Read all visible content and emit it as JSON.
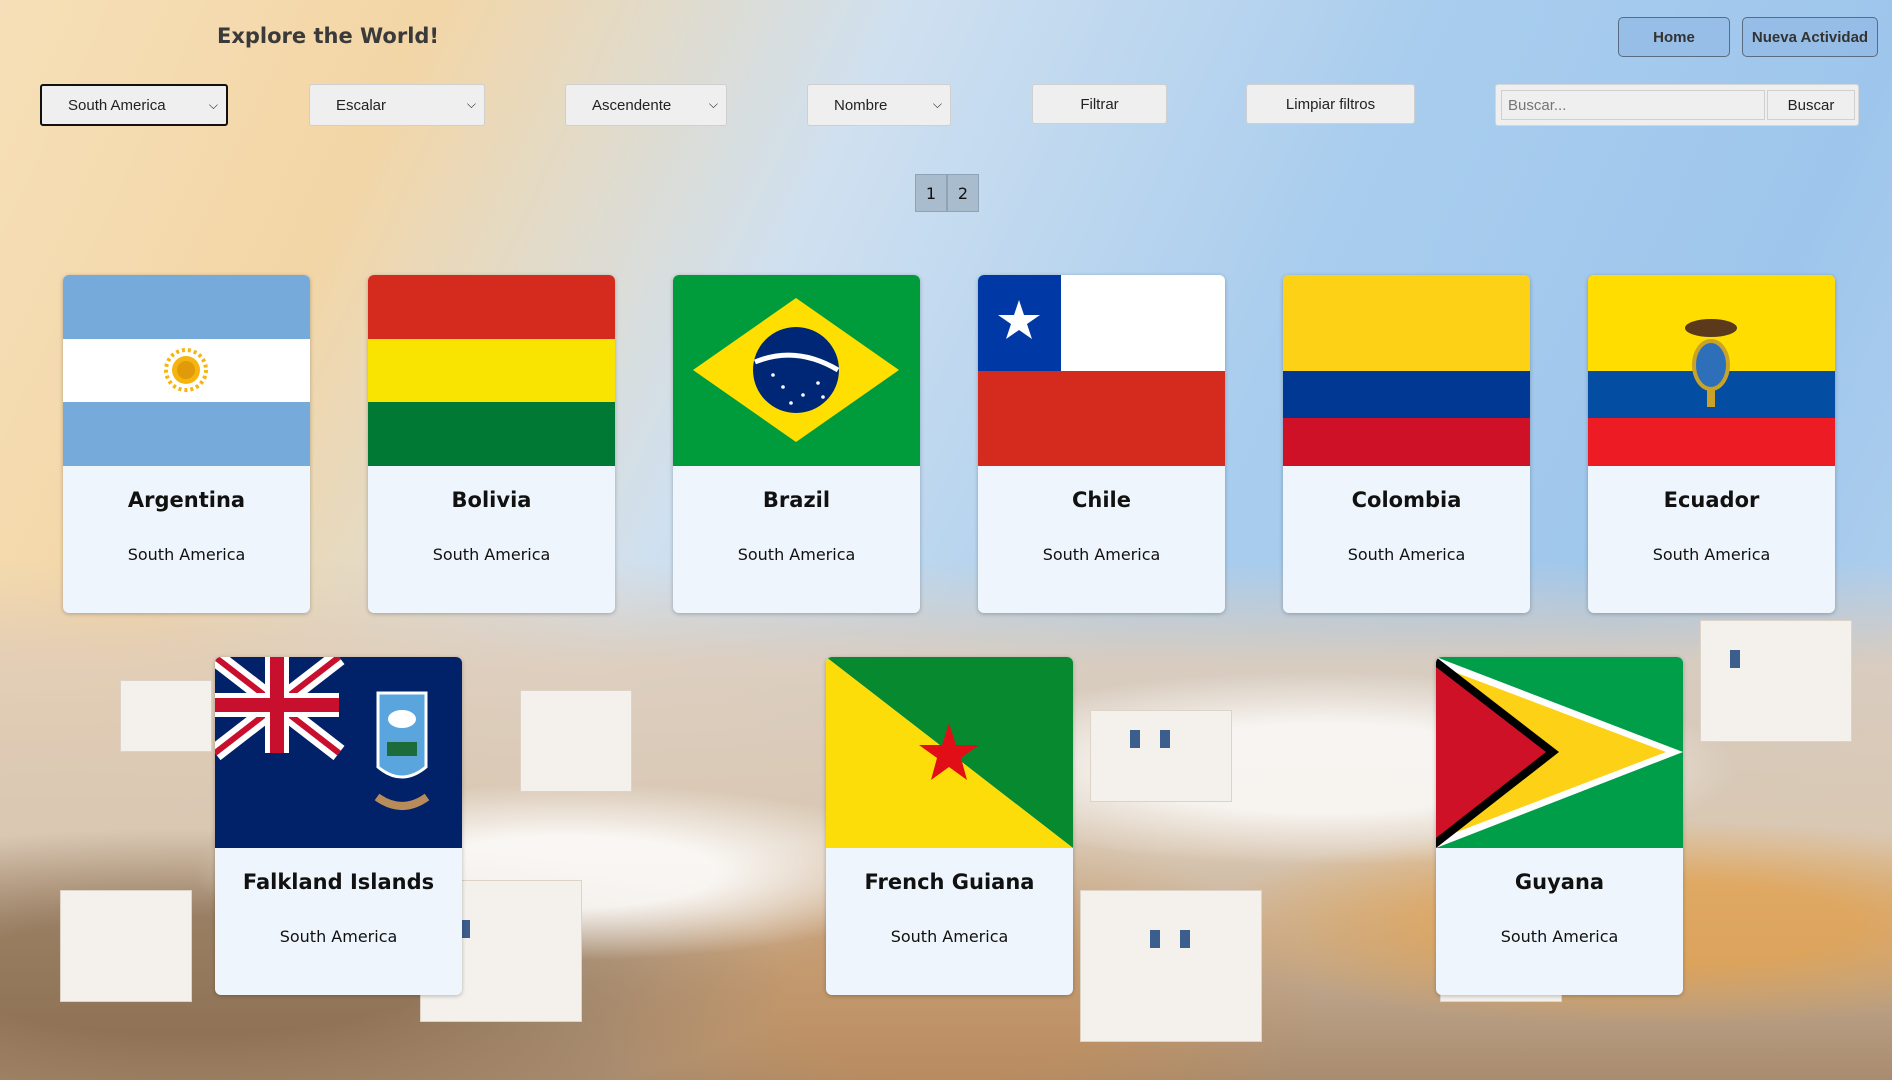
{
  "header": {
    "title": "Explore the World!",
    "nav": {
      "home": "Home",
      "new_activity": "Nueva Actividad"
    }
  },
  "filters": {
    "continent": "South America",
    "activity": "Escalar",
    "order": "Ascendente",
    "sort_by": "Nombre",
    "filter_button": "Filtrar",
    "clear_button": "Limpiar filtros",
    "search_placeholder": "Buscar...",
    "search_button": "Buscar"
  },
  "pagination": [
    "1",
    "2"
  ],
  "countries": [
    {
      "name": "Argentina",
      "continent": "South America",
      "flag": "argentina-flag"
    },
    {
      "name": "Bolivia",
      "continent": "South America",
      "flag": "bolivia-flag"
    },
    {
      "name": "Brazil",
      "continent": "South America",
      "flag": "brazil-flag"
    },
    {
      "name": "Chile",
      "continent": "South America",
      "flag": "chile-flag"
    },
    {
      "name": "Colombia",
      "continent": "South America",
      "flag": "colombia-flag"
    },
    {
      "name": "Ecuador",
      "continent": "South America",
      "flag": "ecuador-flag"
    },
    {
      "name": "Falkland Islands",
      "continent": "South America",
      "flag": "falkland-islands-flag"
    },
    {
      "name": "French Guiana",
      "continent": "South America",
      "flag": "french-guiana-flag"
    },
    {
      "name": "Guyana",
      "continent": "South America",
      "flag": "guyana-flag"
    }
  ],
  "colors": {
    "card_bg": "#eef5fc",
    "pager_bg": "#a9bccd",
    "nav_button_bg": "#8cb4e1"
  }
}
